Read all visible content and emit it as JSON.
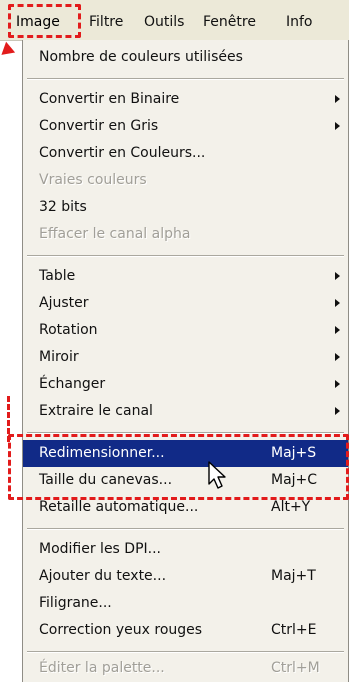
{
  "menubar": {
    "items": [
      {
        "label": "Image"
      },
      {
        "label": "Filtre"
      },
      {
        "label": "Outils"
      },
      {
        "label": "Fenêtre"
      },
      {
        "label": "Info"
      }
    ]
  },
  "menu": {
    "items": [
      {
        "label": "Nombre de couleurs utilisées"
      },
      {
        "label": "Convertir en Binaire",
        "submenu": true
      },
      {
        "label": "Convertir en Gris",
        "submenu": true
      },
      {
        "label": "Convertir en Couleurs..."
      },
      {
        "label": "Vraies couleurs",
        "disabled": true
      },
      {
        "label": "32 bits"
      },
      {
        "label": "Effacer le canal alpha",
        "disabled": true
      },
      {
        "label": "Table",
        "submenu": true
      },
      {
        "label": "Ajuster",
        "submenu": true
      },
      {
        "label": "Rotation",
        "submenu": true
      },
      {
        "label": "Miroir",
        "submenu": true
      },
      {
        "label": "Échanger",
        "submenu": true
      },
      {
        "label": "Extraire le canal",
        "submenu": true
      },
      {
        "label": "Redimensionner...",
        "shortcut": "Maj+S",
        "selected": true
      },
      {
        "label": "Taille du canevas...",
        "shortcut": "Maj+C"
      },
      {
        "label": "Retaille automatique...",
        "shortcut": "Alt+Y"
      },
      {
        "label": "Modifier les DPI..."
      },
      {
        "label": "Ajouter du texte...",
        "shortcut": "Maj+T"
      },
      {
        "label": "Filigrane..."
      },
      {
        "label": "Correction yeux rouges",
        "shortcut": "Ctrl+E"
      },
      {
        "label": "Éditer la palette...",
        "shortcut": "Ctrl+M",
        "disabled": true
      }
    ]
  },
  "colors": {
    "selection": "#112a87",
    "annotation": "#e21b1b",
    "menu_bg": "#f3f1ea",
    "disabled_text": "#a19f98"
  }
}
